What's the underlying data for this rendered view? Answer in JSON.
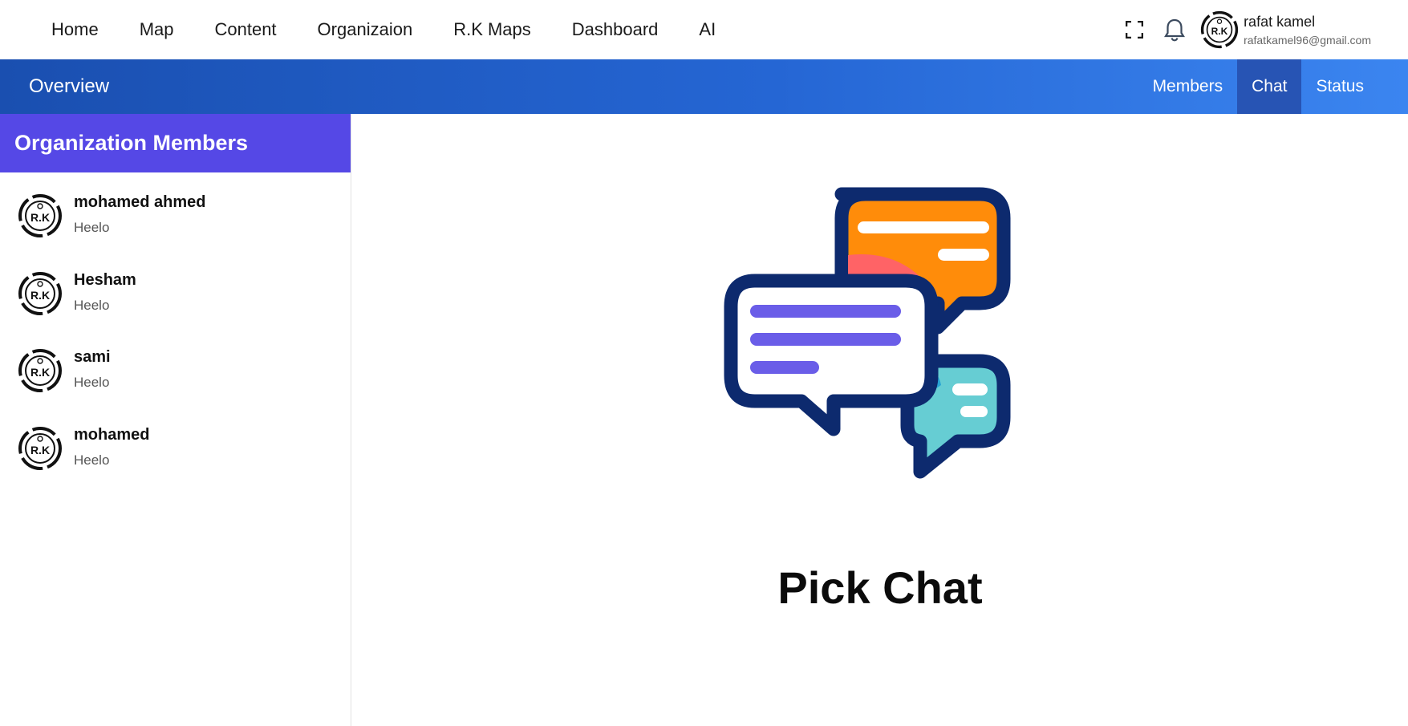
{
  "nav": {
    "items": [
      {
        "label": "Home"
      },
      {
        "label": "Map"
      },
      {
        "label": "Content"
      },
      {
        "label": "Organizaion"
      },
      {
        "label": "R.K Maps"
      },
      {
        "label": "Dashboard"
      },
      {
        "label": "AI"
      }
    ],
    "user": {
      "name": "rafat kamel",
      "email": "rafatkamel96@gmail.com",
      "avatar_text": "R.K"
    },
    "icons": [
      "fullscreen-icon",
      "bell-icon"
    ]
  },
  "band": {
    "title": "Overview",
    "tabs": [
      {
        "label": "Members",
        "active": false
      },
      {
        "label": "Chat",
        "active": true
      },
      {
        "label": "Status",
        "active": false
      }
    ],
    "colors": {
      "start": "#1a4fb0",
      "end": "#3b85f0",
      "active_tab": "#2754b4"
    }
  },
  "sidebar": {
    "title": "Organization Members",
    "header_color": "#5548e6",
    "members": [
      {
        "name": "mohamed ahmed",
        "last_message": "Heelo",
        "avatar_text": "R.K"
      },
      {
        "name": "Hesham",
        "last_message": "Heelo",
        "avatar_text": "R.K"
      },
      {
        "name": "sami",
        "last_message": "Heelo",
        "avatar_text": "R.K"
      },
      {
        "name": "mohamed",
        "last_message": "Heelo",
        "avatar_text": "R.K"
      }
    ]
  },
  "main": {
    "title": "Pick Chat",
    "illustration_icon": "chat-bubbles-icon",
    "colors": {
      "outline": "#0d2a6e",
      "orange": "#ff8c0a",
      "purple": "#6a5de8",
      "teal": "#66cdd3",
      "pink": "#ff6366",
      "teal_dark": "#27a3d3"
    }
  }
}
